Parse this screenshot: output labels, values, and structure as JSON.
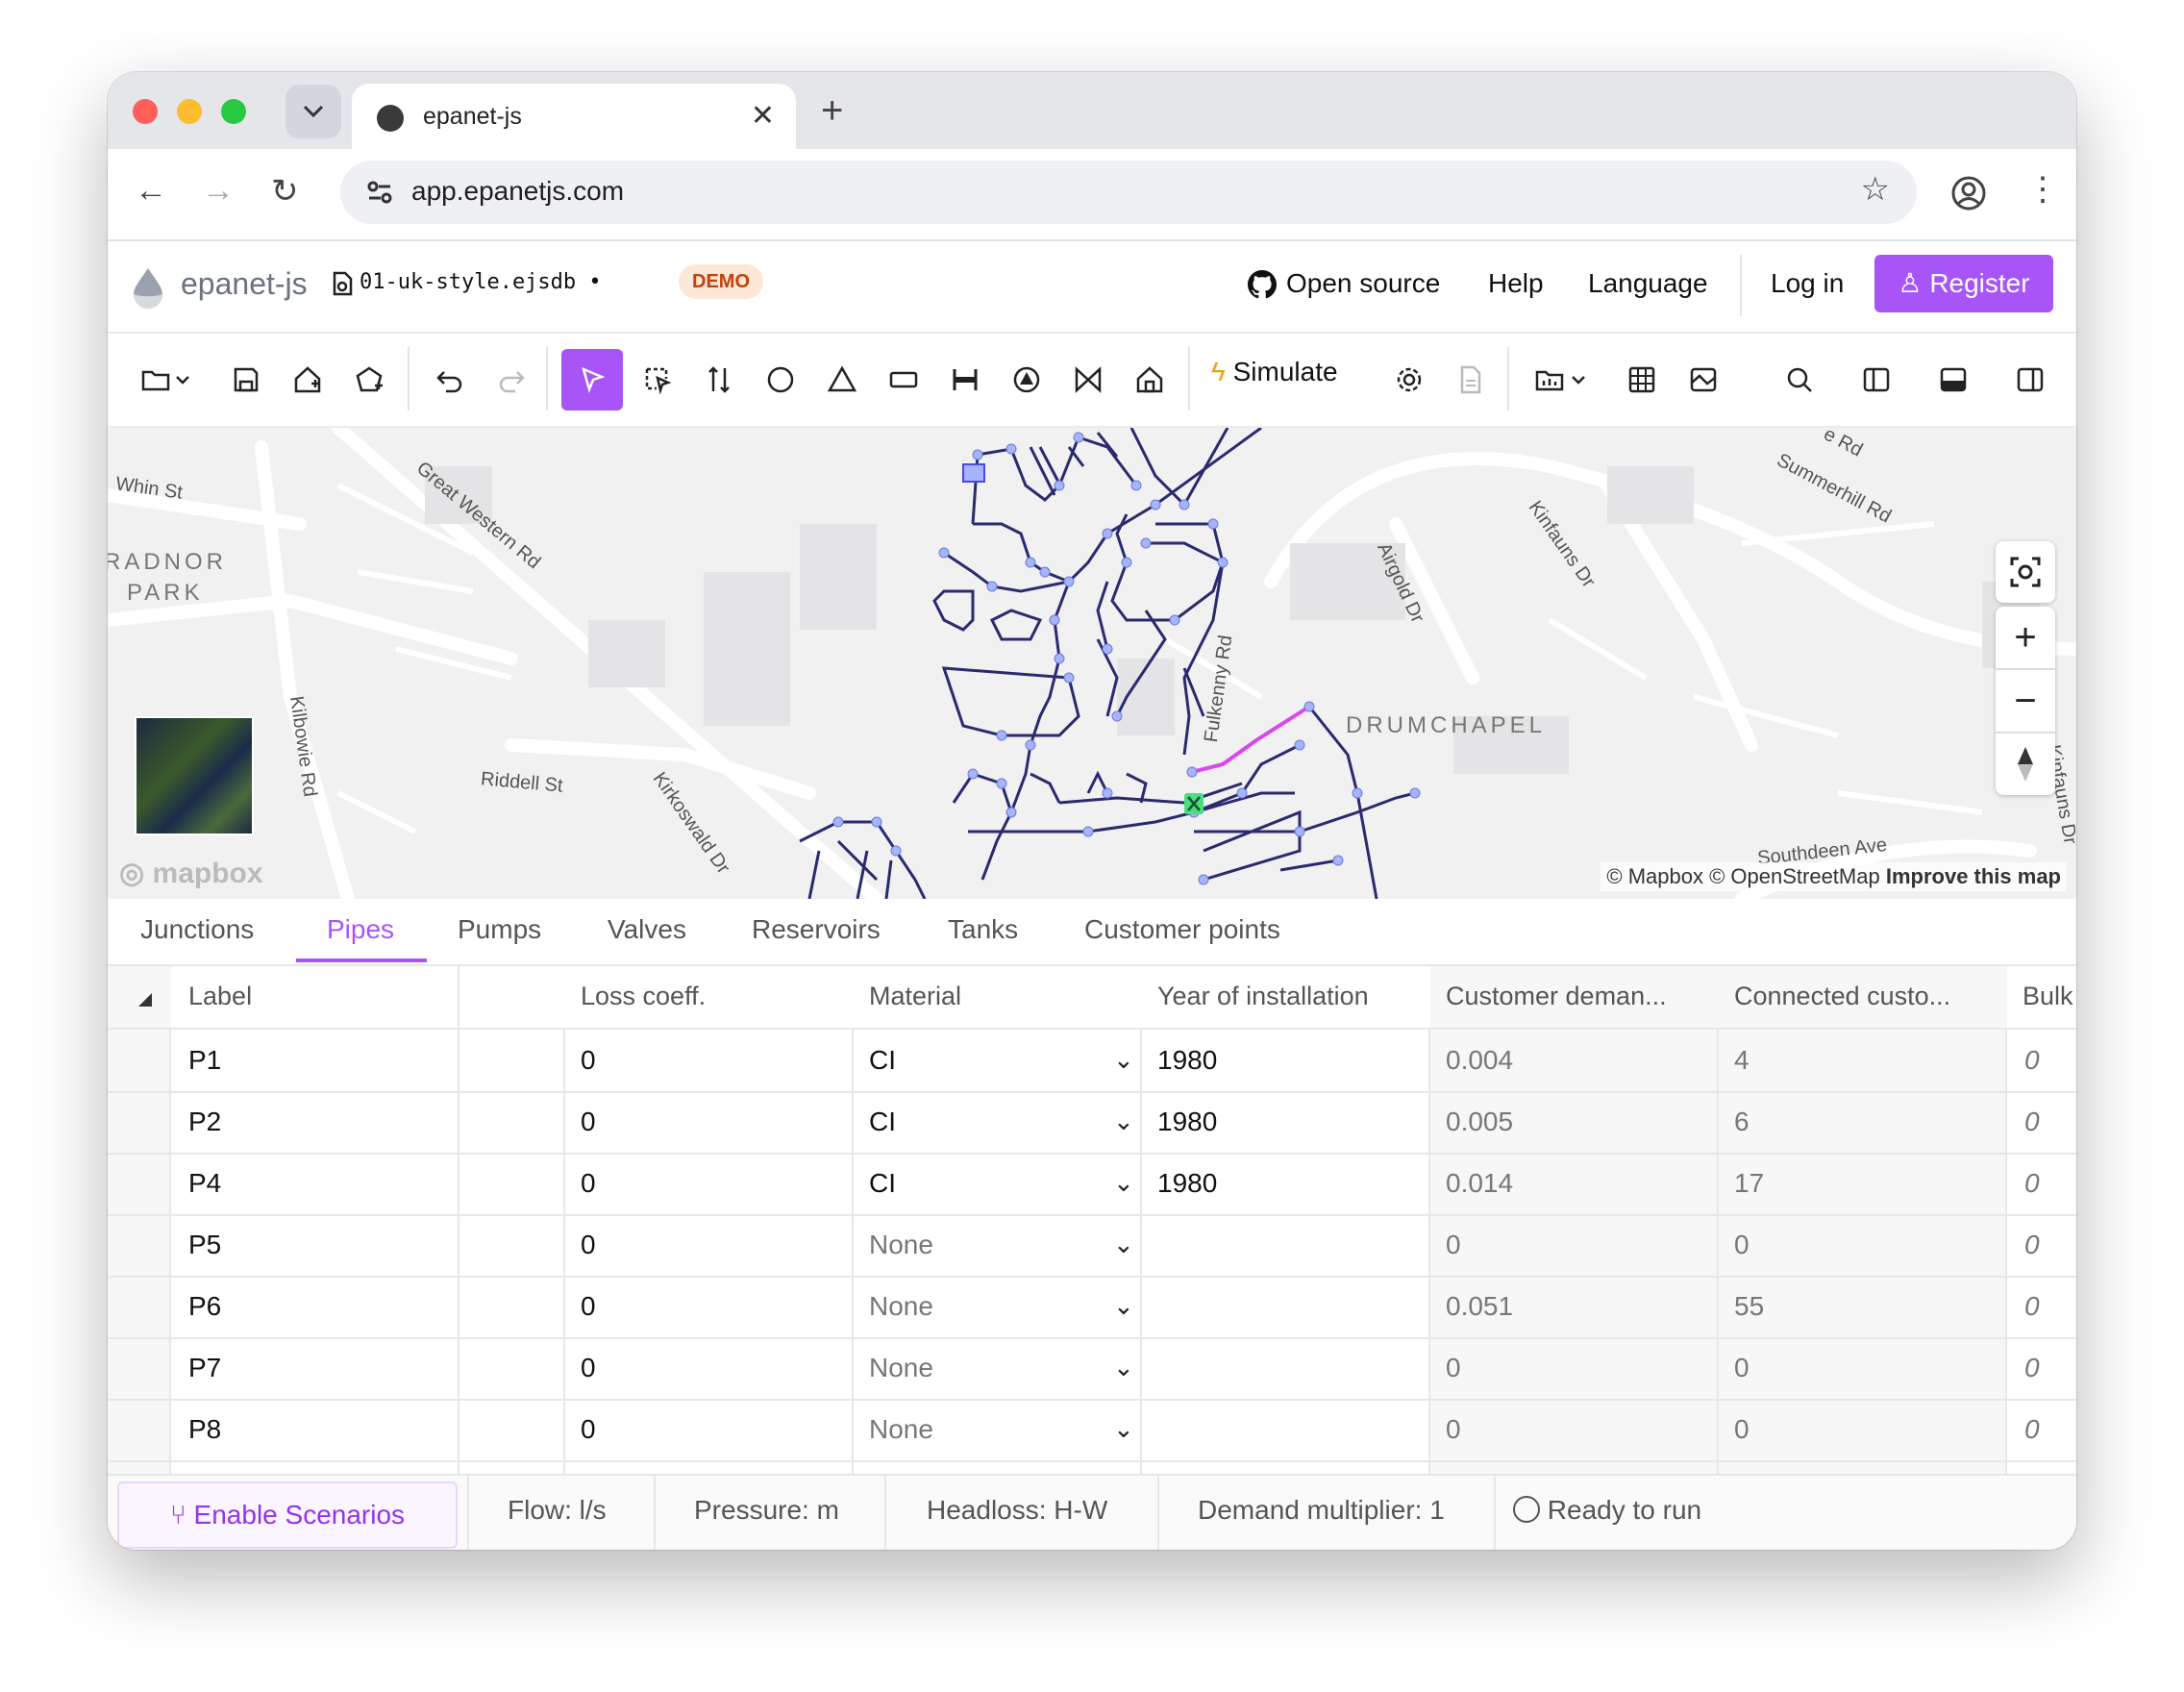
{
  "browser": {
    "tab_title": "epanet-js",
    "url": "app.epanetjs.com"
  },
  "app": {
    "logo_text": "epanet-js",
    "file_name": "01-uk-style.ejsdb",
    "file_dot": "•",
    "demo_badge": "DEMO",
    "nav": {
      "open_source": "Open source",
      "help": "Help",
      "language": "Language",
      "login": "Log in",
      "register": "Register"
    },
    "toolbar": {
      "simulate": "Simulate"
    }
  },
  "map": {
    "streets": [
      "Whin St",
      "Great Western Rd",
      "Kilbowie Rd",
      "Riddell St",
      "Kirkoswald Dr",
      "Summerhill Rd",
      "Kinfauns Dr",
      "Airgold Dr",
      "Southdeen Ave",
      "Kinfauns Dr",
      "Fulkenny Rd",
      "e Rd"
    ],
    "areas": [
      "RADNOR",
      "PARK",
      "DRUMCHAPEL"
    ],
    "attribution": "© Mapbox © OpenStreetMap",
    "improve": "Improve this map",
    "mapbox_logo": "mapbox"
  },
  "data_tabs": [
    "Junctions",
    "Pipes",
    "Pumps",
    "Valves",
    "Reservoirs",
    "Tanks",
    "Customer points"
  ],
  "active_tab": "Pipes",
  "table": {
    "headers": [
      "Label",
      "Loss coeff.",
      "Material",
      "Year of installation",
      "Customer deman...",
      "Connected custo...",
      "Bulk"
    ],
    "rows": [
      {
        "label": "P1",
        "loss": "0",
        "material": "CI",
        "year": "1980",
        "demand": "0.004",
        "customers": "4",
        "bulk": "0"
      },
      {
        "label": "P2",
        "loss": "0",
        "material": "CI",
        "year": "1980",
        "demand": "0.005",
        "customers": "6",
        "bulk": "0"
      },
      {
        "label": "P4",
        "loss": "0",
        "material": "CI",
        "year": "1980",
        "demand": "0.014",
        "customers": "17",
        "bulk": "0"
      },
      {
        "label": "P5",
        "loss": "0",
        "material": "None",
        "year": "",
        "demand": "0",
        "customers": "0",
        "bulk": "0"
      },
      {
        "label": "P6",
        "loss": "0",
        "material": "None",
        "year": "",
        "demand": "0.051",
        "customers": "55",
        "bulk": "0"
      },
      {
        "label": "P7",
        "loss": "0",
        "material": "None",
        "year": "",
        "demand": "0",
        "customers": "0",
        "bulk": "0"
      },
      {
        "label": "P8",
        "loss": "0",
        "material": "None",
        "year": "",
        "demand": "0",
        "customers": "0",
        "bulk": "0"
      }
    ]
  },
  "footer": {
    "scenarios": "Enable Scenarios",
    "flow": "Flow: l/s",
    "pressure": "Pressure: m",
    "headloss": "Headloss: H-W",
    "demand_multiplier": "Demand multiplier: 1",
    "status": "Ready to run"
  },
  "colors": {
    "accent": "#a855f7",
    "network": "#2a2a6e",
    "selected_pipe": "#d946ef"
  }
}
